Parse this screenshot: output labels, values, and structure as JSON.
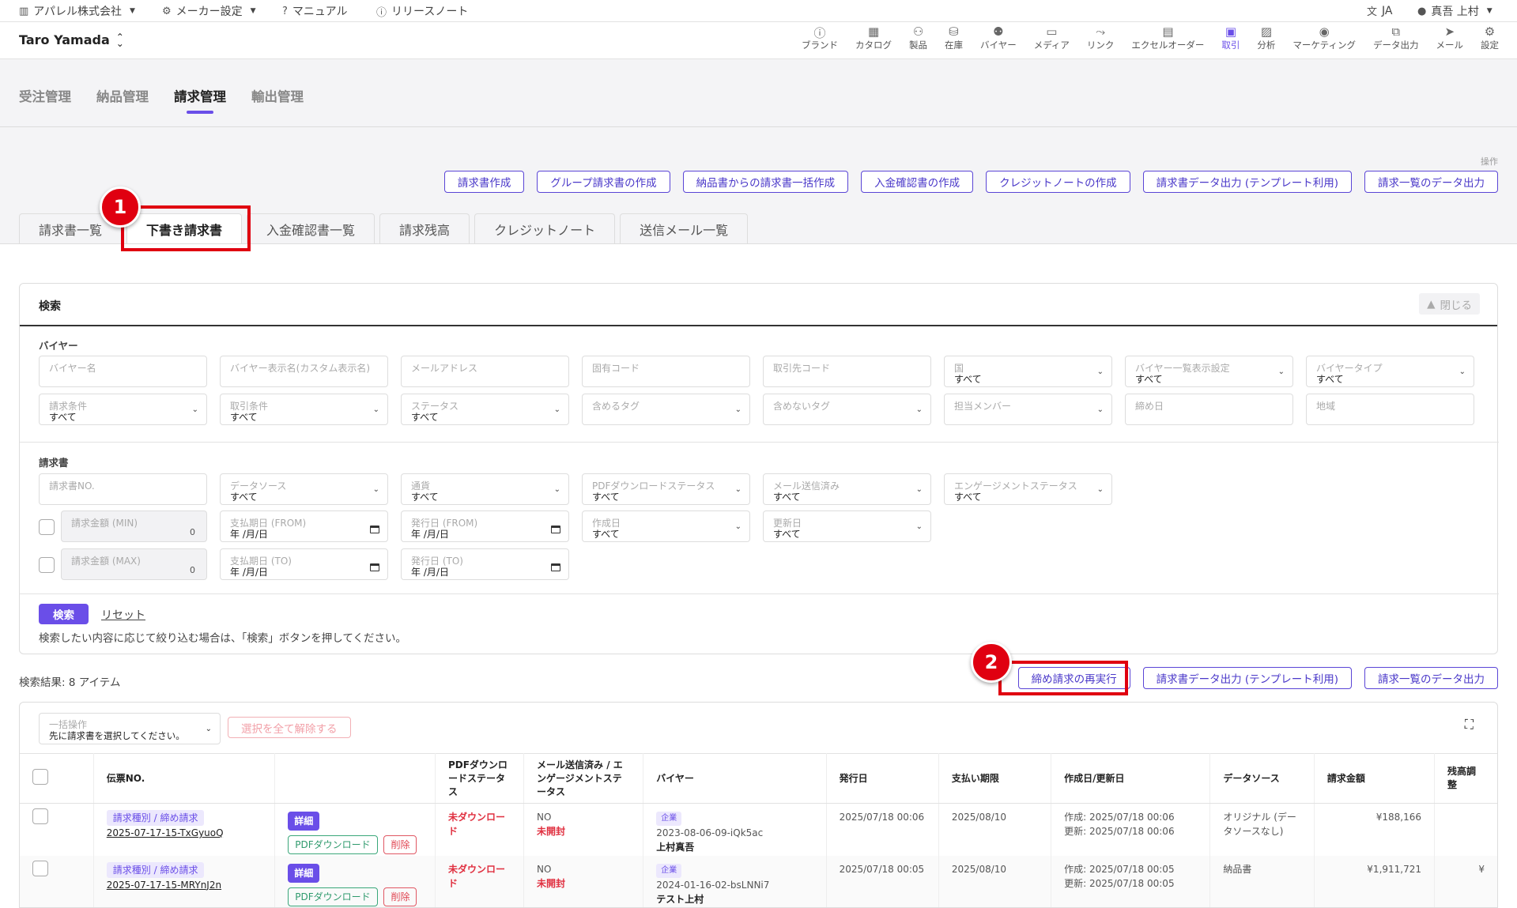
{
  "topbar": {
    "company": "アパレル株式会社",
    "maker_settings": "メーカー設定",
    "manual": "マニュアル",
    "release_notes": "リリースノート",
    "language": "JA",
    "user": "真吾 上村"
  },
  "header": {
    "account": "Taro Yamada",
    "nav": [
      {
        "label": "ブランド",
        "icon": "brand-icon"
      },
      {
        "label": "カタログ",
        "icon": "catalog-icon"
      },
      {
        "label": "製品",
        "icon": "product-icon"
      },
      {
        "label": "在庫",
        "icon": "inventory-icon"
      },
      {
        "label": "バイヤー",
        "icon": "buyer-icon"
      },
      {
        "label": "メディア",
        "icon": "media-icon"
      },
      {
        "label": "リンク",
        "icon": "link-icon"
      },
      {
        "label": "エクセルオーダー",
        "icon": "excel-order-icon"
      },
      {
        "label": "取引",
        "icon": "transaction-icon"
      },
      {
        "label": "分析",
        "icon": "analytics-icon"
      },
      {
        "label": "マーケティング",
        "icon": "marketing-icon"
      },
      {
        "label": "データ出力",
        "icon": "data-export-icon"
      },
      {
        "label": "メール",
        "icon": "mail-icon"
      },
      {
        "label": "設定",
        "icon": "settings-icon"
      }
    ]
  },
  "main_tabs": [
    "受注管理",
    "納品管理",
    "請求管理",
    "輸出管理"
  ],
  "operations": {
    "label": "操作",
    "buttons": [
      "請求書作成",
      "グループ請求書の作成",
      "納品書からの請求書一括作成",
      "入金確認書の作成",
      "クレジットノートの作成",
      "請求書データ出力 (テンプレート利用)",
      "請求一覧のデータ出力"
    ]
  },
  "sub_tabs": [
    "請求書一覧",
    "下書き請求書",
    "入金確認書一覧",
    "請求残高",
    "クレジットノート",
    "送信メール一覧"
  ],
  "markers": [
    "1",
    "2"
  ],
  "search": {
    "title": "検索",
    "close": "閉じる",
    "buyer_section": "バイヤー",
    "invoice_section": "請求書",
    "buyer_fields": [
      {
        "ph": "バイヤー名",
        "val": ""
      },
      {
        "ph": "バイヤー表示名(カスタム表示名)",
        "val": ""
      },
      {
        "ph": "メールアドレス",
        "val": ""
      },
      {
        "ph": "固有コード",
        "val": ""
      },
      {
        "ph": "取引先コード",
        "val": ""
      },
      {
        "ph": "国",
        "val": "すべて"
      },
      {
        "ph": "バイヤー一覧表示設定",
        "val": "すべて"
      },
      {
        "ph": "バイヤータイプ",
        "val": "すべて"
      },
      {
        "ph": "請求条件",
        "val": "すべて"
      },
      {
        "ph": "取引条件",
        "val": "すべて"
      },
      {
        "ph": "ステータス",
        "val": "すべて"
      },
      {
        "ph": "含めるタグ",
        "val": ""
      },
      {
        "ph": "含めないタグ",
        "val": ""
      },
      {
        "ph": "担当メンバー",
        "val": ""
      },
      {
        "ph": "締め日",
        "val": ""
      },
      {
        "ph": "地域",
        "val": ""
      }
    ],
    "invoice_fields": {
      "invoice_no": "請求書NO.",
      "data_source": {
        "ph": "データソース",
        "val": "すべて"
      },
      "currency": {
        "ph": "通貨",
        "val": "すべて"
      },
      "pdf_status": {
        "ph": "PDFダウンロードステータス",
        "val": "すべて"
      },
      "mail_sent": {
        "ph": "メール送信済み",
        "val": "すべて"
      },
      "engagement": {
        "ph": "エンゲージメントステータス",
        "val": "すべて"
      },
      "amount_min": {
        "ph": "請求金額 (MIN)",
        "val": "0"
      },
      "amount_max": {
        "ph": "請求金額 (MAX)",
        "val": "0"
      },
      "due_from": {
        "ph": "支払期日 (FROM)",
        "val": "年 /月/日"
      },
      "due_to": {
        "ph": "支払期日 (TO)",
        "val": "年 /月/日"
      },
      "issue_from": {
        "ph": "発行日 (FROM)",
        "val": "年 /月/日"
      },
      "issue_to": {
        "ph": "発行日 (TO)",
        "val": "年 /月/日"
      },
      "created": {
        "ph": "作成日",
        "val": "すべて"
      },
      "updated": {
        "ph": "更新日",
        "val": "すべて"
      }
    },
    "search_button": "検索",
    "reset": "リセット",
    "hint": "検索したい内容に応じて絞り込む場合は、「検索」ボタンを押してください。"
  },
  "results": {
    "count": "検索結果: 8 アイテム",
    "actions": [
      "締め請求の再実行",
      "請求書データ出力 (テンプレート利用)",
      "請求一覧のデータ出力"
    ],
    "bulk_label": "一括操作",
    "bulk_value": "先に請求書を選択してください。",
    "deselect": "選択を全て解除する"
  },
  "table": {
    "headers": [
      "伝票NO.",
      "",
      "PDFダウンロードステータス",
      "メール送信済み / エンゲージメントステータス",
      "バイヤー",
      "発行日",
      "支払い期限",
      "作成日/更新日",
      "データソース",
      "請求金額",
      "残高調整"
    ],
    "rows": [
      {
        "type": "請求種別 / 締め請求",
        "slip": "2025-07-17-15-TxGyuoQ",
        "detail": "詳細",
        "pdf": "PDFダウンロード",
        "delete": "削除",
        "pdf_status": "未ダウンロード",
        "mail": "NO",
        "engagement": "未開封",
        "buyer_tag": "企業",
        "buyer_code": "2023-08-06-09-iQk5ac",
        "buyer_name": "上村真吾",
        "issued": "2025/07/18 00:06",
        "due": "2025/08/10",
        "created": "作成: 2025/07/18 00:06",
        "updated": "更新: 2025/07/18 00:06",
        "source": "オリジナル (データソースなし)",
        "amount": "¥188,166",
        "adjust": ""
      },
      {
        "type": "請求種別 / 締め請求",
        "slip": "2025-07-17-15-MRYnJ2n",
        "detail": "詳細",
        "pdf": "PDFダウンロード",
        "delete": "削除",
        "pdf_status": "未ダウンロード",
        "mail": "NO",
        "engagement": "未開封",
        "buyer_tag": "企業",
        "buyer_code": "2024-01-16-02-bsLNNi7",
        "buyer_name": "テスト上村",
        "issued": "2025/07/18 00:05",
        "due": "2025/08/10",
        "created": "作成: 2025/07/18 00:05",
        "updated": "更新: 2025/07/18 00:05",
        "source": "納品書",
        "amount": "¥1,911,721",
        "adjust": "¥"
      }
    ]
  },
  "colors": {
    "accent": "#6a4ee8",
    "highlight": "#e00010"
  }
}
